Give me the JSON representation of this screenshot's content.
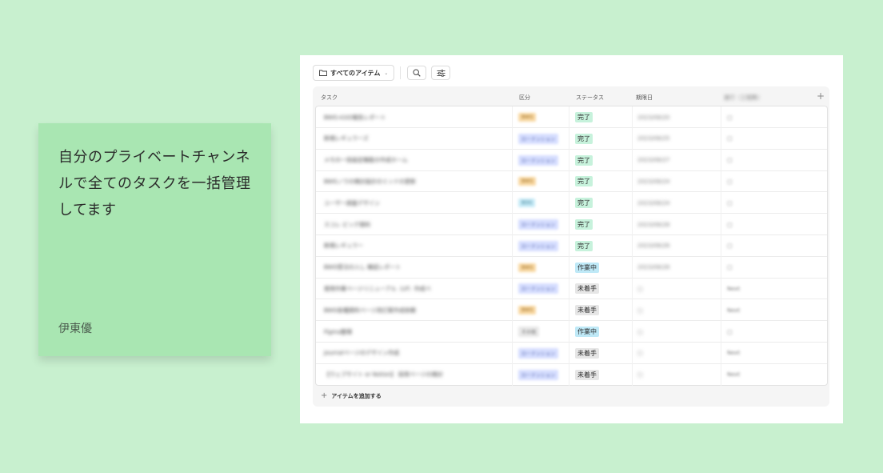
{
  "note": {
    "text": "自分のプライベートチャンネルで全てのタスクを一括管理してます",
    "author": "伊東優"
  },
  "toolbar": {
    "view_label": "すべてのアイテム",
    "view_icon": "folder-icon",
    "search_icon": "search-icon",
    "filter_icon": "sliders-icon"
  },
  "table": {
    "headers": {
      "task": "タスク",
      "category": "区分",
      "status": "ステータス",
      "due": "期限日",
      "extra": "進行（工程数）",
      "add": "+"
    },
    "rows": [
      {
        "task": "BWG-A3の報告レポート",
        "category": "BWG",
        "status": "完了",
        "due": "2023/08/20",
        "check": "□"
      },
      {
        "task": "新規レギュラーズ",
        "category": "ローテンション",
        "status": "完了",
        "due": "2023/08/25",
        "check": "□"
      },
      {
        "task": "メモの一括設定機能の作成ホーム",
        "category": "ローテンション",
        "status": "完了",
        "due": "2023/08/27",
        "check": "□"
      },
      {
        "task": "BWGノウの検討設計のミッドの更新",
        "category": "BWG",
        "status": "完了",
        "due": "2023/08/24",
        "check": "□"
      },
      {
        "task": "ユーザー調査デザイン",
        "category": "BDG",
        "status": "完了",
        "due": "2023/08/24",
        "check": "□"
      },
      {
        "task": "スコレ ビッグ資料",
        "category": "ローテンション",
        "status": "完了",
        "due": "2023/08/28",
        "check": "□"
      },
      {
        "task": "新規レギュラー",
        "category": "ローテンション",
        "status": "完了",
        "due": "2023/08/26",
        "check": "□"
      },
      {
        "task": "BWG受注の入し 確認レポート",
        "category": "BWG",
        "status": "作業中",
        "due": "2023/08/28",
        "check": "□"
      },
      {
        "task": "使用作業ページリニューアル（LP）作成ペ",
        "category": "ローテンション",
        "status": "未着手",
        "due": "□",
        "check": "Next"
      },
      {
        "task": "BWG各種資料ページ改訂案作成依頼",
        "category": "BWG",
        "status": "未着手",
        "due": "□",
        "check": "Next"
      },
      {
        "task": "Figma整理",
        "category": "その他",
        "status": "作業中",
        "due": "□",
        "check": "□"
      },
      {
        "task": "Journalページのデザイン作成",
        "category": "ローテンション",
        "status": "未着手",
        "due": "□",
        "check": "Next"
      },
      {
        "task": "【ウェブサイト or Notion】 採用ページの検討",
        "category": "ローテンション",
        "status": "未着手",
        "due": "□",
        "check": "Next"
      }
    ],
    "add_item": "アイテムを追加する"
  },
  "colors": {
    "background": "#c8f0cf",
    "note": "#a9e6b2",
    "done": "#c7f2dc",
    "in_progress": "#bfe9f7",
    "not_started": "#e6e6e6",
    "cat_bwg": "#f9d9a4",
    "cat_rotation": "#d6deff",
    "cat_bdg": "#c7ebf7",
    "cat_other": "#e8e8e8"
  }
}
